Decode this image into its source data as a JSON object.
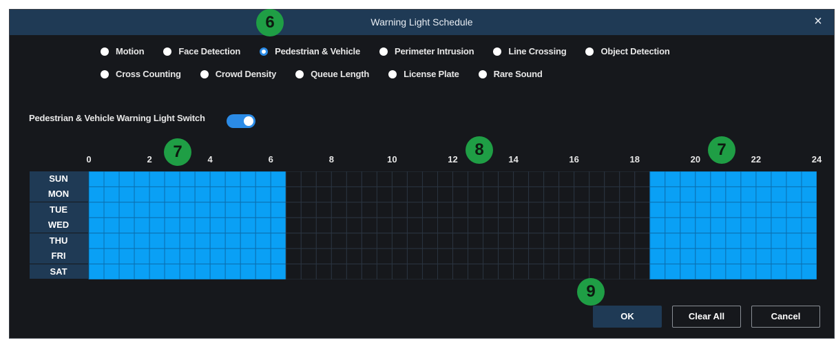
{
  "dialog": {
    "title": "Warning Light Schedule",
    "close_glyph": "×"
  },
  "detection_types": {
    "row1": [
      {
        "label": "Motion",
        "selected": false
      },
      {
        "label": "Face Detection",
        "selected": false
      },
      {
        "label": "Pedestrian & Vehicle",
        "selected": true
      },
      {
        "label": "Perimeter Intrusion",
        "selected": false
      },
      {
        "label": "Line Crossing",
        "selected": false
      },
      {
        "label": "Object Detection",
        "selected": false
      }
    ],
    "row2": [
      {
        "label": "Cross Counting",
        "selected": false
      },
      {
        "label": "Crowd Density",
        "selected": false
      },
      {
        "label": "Queue Length",
        "selected": false
      },
      {
        "label": "License Plate",
        "selected": false
      },
      {
        "label": "Rare Sound",
        "selected": false
      }
    ]
  },
  "switch": {
    "label": "Pedestrian & Vehicle Warning Light Switch",
    "on": true
  },
  "schedule": {
    "hour_labels": [
      "0",
      "2",
      "4",
      "6",
      "8",
      "10",
      "12",
      "14",
      "16",
      "18",
      "20",
      "22",
      "24"
    ],
    "days": [
      "SUN",
      "MON",
      "TUE",
      "WED",
      "THU",
      "FRI",
      "SAT"
    ],
    "active_ranges_hours": [
      [
        0,
        6.5
      ],
      [
        18.5,
        24
      ]
    ],
    "active_color": "#0aa0f5",
    "inactive_color": "#16181c"
  },
  "buttons": {
    "ok": "OK",
    "clear_all": "Clear All",
    "cancel": "Cancel"
  },
  "callouts": [
    "6",
    "7",
    "8",
    "7",
    "9"
  ],
  "colors": {
    "accent": "#2b8be6",
    "titlebar": "#1f3a55",
    "callout": "#1f9e45"
  }
}
